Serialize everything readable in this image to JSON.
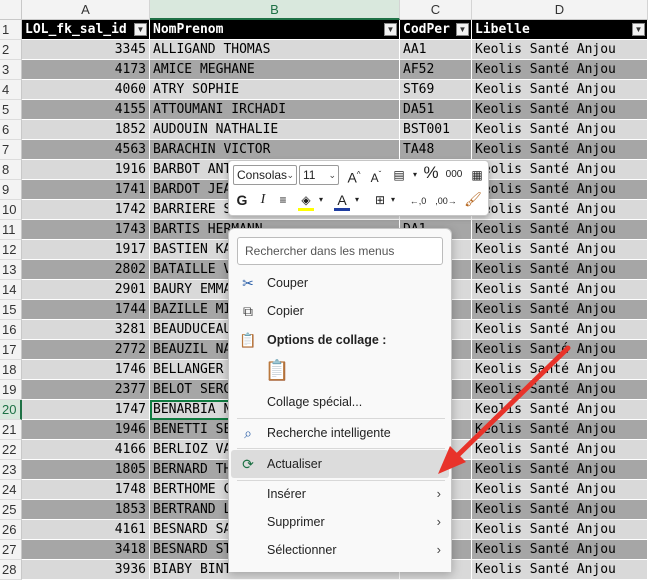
{
  "columns": [
    {
      "letter": "A",
      "header": "LOL_fk_sal_id"
    },
    {
      "letter": "B",
      "header": "NomPrenom"
    },
    {
      "letter": "C",
      "header": "CodPer"
    },
    {
      "letter": "D",
      "header": "Libelle"
    }
  ],
  "rows": [
    {
      "n": "2",
      "id": "3345",
      "name": "ALLIGAND THOMAS",
      "code": "AA1",
      "lib": "Keolis Santé Anjou"
    },
    {
      "n": "3",
      "id": "4173",
      "name": "AMICE MEGHANE",
      "code": "AF52",
      "lib": "Keolis Santé Anjou"
    },
    {
      "n": "4",
      "id": "4060",
      "name": "ATRY SOPHIE",
      "code": "ST69",
      "lib": "Keolis Santé Anjou"
    },
    {
      "n": "5",
      "id": "4155",
      "name": "ATTOUMANI IRCHADI",
      "code": "DA51",
      "lib": "Keolis Santé Anjou"
    },
    {
      "n": "6",
      "id": "1852",
      "name": "AUDOUIN NATHALIE",
      "code": "BST001",
      "lib": "Keolis Santé Anjou"
    },
    {
      "n": "7",
      "id": "4563",
      "name": "BARACHIN VICTOR",
      "code": "TA48",
      "lib": "Keolis Santé Anjou"
    },
    {
      "n": "8",
      "id": "1916",
      "name": "BARBOT ANT",
      "code": "",
      "lib": "Keolis Santé Anjou"
    },
    {
      "n": "9",
      "id": "1741",
      "name": "BARDOT JEA",
      "code": "",
      "lib": "Keolis Santé Anjou"
    },
    {
      "n": "10",
      "id": "1742",
      "name": "BARRIERE S",
      "code": "",
      "lib": "Keolis Santé Anjou"
    },
    {
      "n": "11",
      "id": "1743",
      "name": "BARTIS HERMANN",
      "code": "DA1",
      "lib": "Keolis Santé Anjou"
    },
    {
      "n": "12",
      "id": "1917",
      "name": "BASTIEN KA",
      "code": "",
      "lib": "Keolis Santé Anjou"
    },
    {
      "n": "13",
      "id": "2802",
      "name": "BATAILLE V",
      "code": "",
      "lib": "Keolis Santé Anjou"
    },
    {
      "n": "14",
      "id": "2901",
      "name": "BAURY EMMA",
      "code": "",
      "lib": "Keolis Santé Anjou"
    },
    {
      "n": "15",
      "id": "1744",
      "name": "BAZILLE MI",
      "code": "",
      "lib": "Keolis Santé Anjou"
    },
    {
      "n": "16",
      "id": "3281",
      "name": "BEAUDUCEAU",
      "code": "",
      "lib": "Keolis Santé Anjou"
    },
    {
      "n": "17",
      "id": "2772",
      "name": "BEAUZIL NA",
      "code": "",
      "lib": "Keolis Santé Anjou"
    },
    {
      "n": "18",
      "id": "1746",
      "name": "BELLANGER",
      "code": "",
      "lib": "Keolis Santé Anjou"
    },
    {
      "n": "19",
      "id": "2377",
      "name": "BELOT SERG",
      "code": "",
      "lib": "Keolis Santé Anjou"
    },
    {
      "n": "20",
      "id": "1747",
      "name": "BENARBIA N",
      "code": "",
      "lib": "Keolis Santé Anjou"
    },
    {
      "n": "21",
      "id": "1946",
      "name": "BENETTI SE",
      "code": "",
      "lib": "Keolis Santé Anjou"
    },
    {
      "n": "22",
      "id": "4166",
      "name": "BERLIOZ VA",
      "code": "",
      "lib": "Keolis Santé Anjou"
    },
    {
      "n": "23",
      "id": "1805",
      "name": "BERNARD TH",
      "code": "",
      "lib": "Keolis Santé Anjou"
    },
    {
      "n": "24",
      "id": "1748",
      "name": "BERTHOME C",
      "code": "",
      "lib": "Keolis Santé Anjou"
    },
    {
      "n": "25",
      "id": "1853",
      "name": "BERTRAND L",
      "code": "",
      "lib": "Keolis Santé Anjou"
    },
    {
      "n": "26",
      "id": "4161",
      "name": "BESNARD SA",
      "code": "",
      "lib": "Keolis Santé Anjou"
    },
    {
      "n": "27",
      "id": "3418",
      "name": "BESNARD ST",
      "code": "",
      "lib": "Keolis Santé Anjou"
    },
    {
      "n": "28",
      "id": "3936",
      "name": "BIABY BINT",
      "code": "",
      "lib": "Keolis Santé Anjou"
    }
  ],
  "mini_toolbar": {
    "font_name": "Consolas",
    "font_size": "11",
    "grow_font": "A",
    "shrink_font": "A",
    "percent": "%",
    "thousands": "000",
    "bold": "G",
    "italic": "I",
    "font_color_letter": "A",
    "dec_inc": "←,0",
    "dec_dec": ",00→"
  },
  "context_menu": {
    "search_placeholder": "Rechercher dans les menus",
    "items": [
      {
        "label": "Couper",
        "icon": "scissors-icon"
      },
      {
        "label": "Copier",
        "icon": "copy-icon"
      },
      {
        "label": "Options de collage :",
        "icon": "paste-icon"
      },
      {
        "label": "Collage spécial...",
        "icon": ""
      },
      {
        "label": "Recherche intelligente",
        "icon": "smart-lookup-icon"
      },
      {
        "label": "Actualiser",
        "icon": "refresh-icon"
      },
      {
        "label": "Insérer",
        "icon": "",
        "submenu": "›"
      },
      {
        "label": "Supprimer",
        "icon": "",
        "submenu": "›"
      },
      {
        "label": "Sélectionner",
        "icon": "",
        "submenu": "›"
      }
    ]
  },
  "colors": {
    "accent": "#107c41",
    "annotation_arrow": "#e8332a",
    "row_dark": "#a6a6a6",
    "row_light": "#d9d9d9"
  }
}
